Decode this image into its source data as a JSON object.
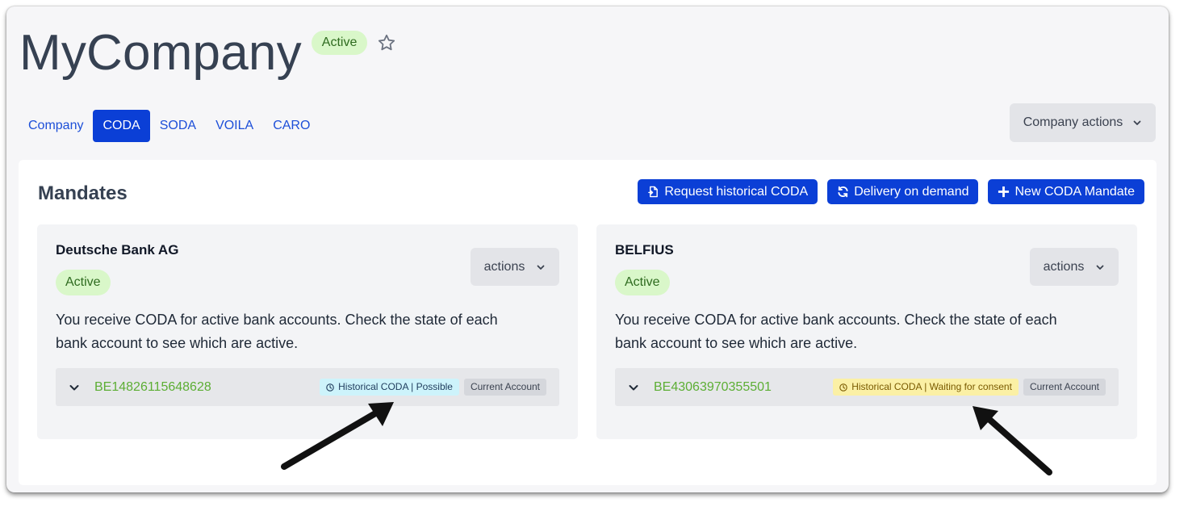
{
  "header": {
    "title": "MyCompany",
    "status_badge": "Active",
    "star_icon": "star-outline-icon"
  },
  "tabs": [
    {
      "label": "Company",
      "active": false
    },
    {
      "label": "CODA",
      "active": true
    },
    {
      "label": "SODA",
      "active": false
    },
    {
      "label": "VOILA",
      "active": false
    },
    {
      "label": "CARO",
      "active": false
    }
  ],
  "company_actions": {
    "label": "Company actions",
    "icon": "chevron-down-icon"
  },
  "panel": {
    "title": "Mandates",
    "buttons": [
      {
        "label": "Request historical CODA",
        "icon": "history-file-icon"
      },
      {
        "label": "Delivery on demand",
        "icon": "refresh-icon"
      },
      {
        "label": "New CODA Mandate",
        "icon": "plus-icon"
      }
    ]
  },
  "mandates": [
    {
      "bank": "Deutsche Bank AG",
      "status": "Active",
      "actions_label": "actions",
      "description": "You receive CODA for active bank accounts. Check the state of each bank account to see which are active.",
      "account": {
        "iban": "BE14826115648628",
        "historical_badge": "Historical CODA | Possible",
        "type": "Current Account"
      }
    },
    {
      "bank": "BELFIUS",
      "status": "Active",
      "actions_label": "actions",
      "description": "You receive CODA for active bank accounts. Check the state of each bank account to see which are active.",
      "account": {
        "iban": "BE43063970355501",
        "historical_badge": "Historical CODA | Waiting for consent",
        "type": "Current Account"
      }
    }
  ],
  "colors": {
    "primary": "#0b3fd6",
    "active_badge_bg": "#d9f7c9",
    "iban_text": "#5cae34",
    "possible_badge_bg": "#cdf3fb",
    "waiting_badge_bg": "#fbf0a5"
  }
}
